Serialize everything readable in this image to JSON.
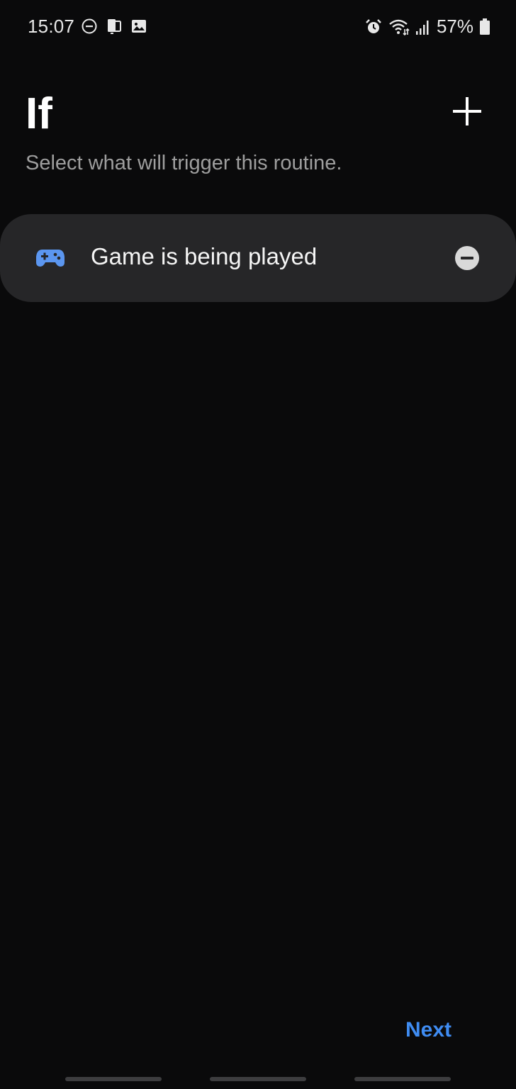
{
  "status_bar": {
    "time": "15:07",
    "battery": "57%",
    "left_icons": [
      "do-not-disturb-icon",
      "phone-sync-icon",
      "image-icon"
    ],
    "right_icons": [
      "alarm-icon",
      "wifi-icon",
      "signal-icon",
      "battery-icon"
    ]
  },
  "header": {
    "title": "If",
    "subtitle": "Select what will trigger this routine.",
    "add_icon": "plus-icon"
  },
  "triggers": [
    {
      "label": "Game is being played",
      "icon": "gamepad-icon",
      "remove_icon": "minus-circle-icon"
    }
  ],
  "footer": {
    "next_label": "Next"
  },
  "colors": {
    "background": "#0a0a0b",
    "card": "#262628",
    "accent": "#3f8cf2",
    "subtitle": "#9e9e9e"
  }
}
